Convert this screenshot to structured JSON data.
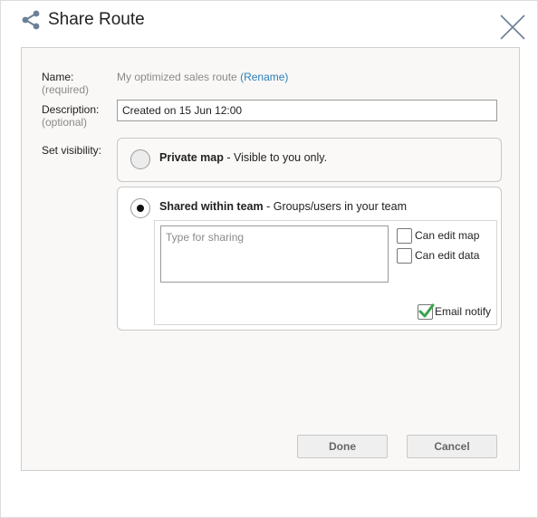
{
  "dialog": {
    "title": "Share Route",
    "icons": {
      "share": "share-icon",
      "close": "close-icon"
    }
  },
  "form": {
    "name_label": "Name:",
    "name_sub": "(required)",
    "route_name": "My optimized sales route",
    "rename_link": "(Rename)",
    "description_label": "Description:",
    "description_sub": "(optional)",
    "description_value": "Created on 15 Jun 12:00",
    "visibility_label": "Set visibility:"
  },
  "visibility": {
    "private": {
      "title": "Private map",
      "desc": " - Visible to you only.",
      "selected": false
    },
    "shared": {
      "title": "Shared within team",
      "desc": " - Groups/users in your team",
      "selected": true
    }
  },
  "sharing": {
    "placeholder": "Type for sharing",
    "can_edit_map": {
      "label": "Can edit map",
      "checked": false
    },
    "can_edit_data": {
      "label": "Can edit data",
      "checked": false
    },
    "email_notify": {
      "label": "Email notify",
      "checked": true
    }
  },
  "buttons": {
    "done": "Done",
    "cancel": "Cancel"
  },
  "colors": {
    "link": "#2a7fb8",
    "check": "#3aa34a",
    "icon": "#6b7f97"
  }
}
